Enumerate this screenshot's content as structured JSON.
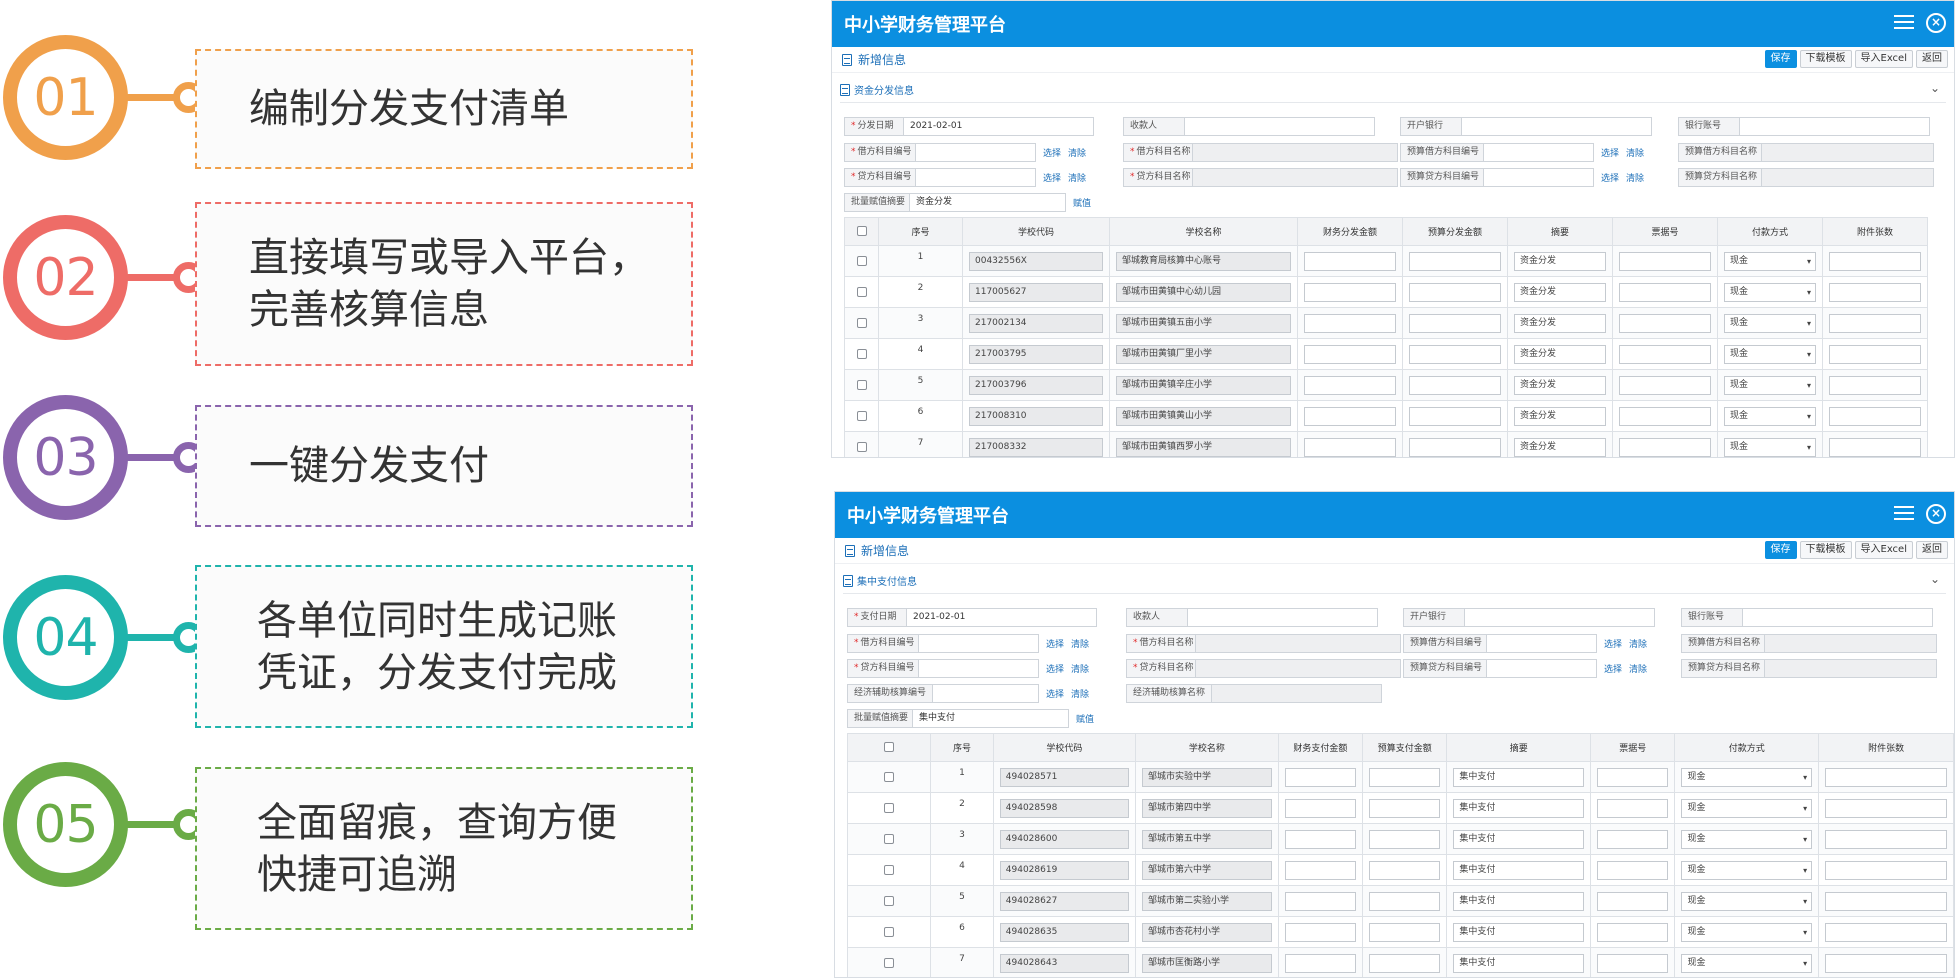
{
  "steps": [
    {
      "num": "01",
      "text": "编制分发支付清单",
      "color": "#f0a04b"
    },
    {
      "num": "02",
      "text": "直接填写或导入平台，\n完善核算信息",
      "color": "#ee6c67"
    },
    {
      "num": "03",
      "text": "一键分发支付",
      "color": "#8a64ad"
    },
    {
      "num": "04",
      "text": "各单位同时生成记账\n凭证，分发支付完成",
      "color": "#1fb4ac"
    },
    {
      "num": "05",
      "text": "全面留痕，查询方便\n快捷可追溯",
      "color": "#6aab46"
    }
  ],
  "panel1": {
    "title": "中小学财务管理平台",
    "new_info": "新增信息",
    "buttons": {
      "save": "保存",
      "download": "下载模板",
      "import": "导入Excel",
      "back": "返回"
    },
    "section": "资金分发信息",
    "form": {
      "date_label": "分发日期",
      "date_value": "2021-02-01",
      "payee_label": "收款人",
      "bank_label": "开户银行",
      "account_label": "银行账号",
      "debit_code": "借方科目编号",
      "debit_name": "借方科目名称",
      "credit_code": "贷方科目编号",
      "credit_name": "贷方科目名称",
      "budget_debit_code": "预算借方科目编号",
      "budget_debit_name": "预算借方科目名称",
      "budget_credit_code": "预算贷方科目编号",
      "budget_credit_name": "预算贷方科目名称",
      "select": "选择",
      "clear": "清除",
      "batch_label": "批量赋值摘要",
      "batch_value": "资金分发",
      "assign": "赋值"
    },
    "columns": [
      "序号",
      "学校代码",
      "学校名称",
      "财务分发金额",
      "预算分发金额",
      "摘要",
      "票据号",
      "付款方式",
      "附件张数"
    ],
    "rows": [
      {
        "no": "1",
        "code": "00432556X",
        "name": "邹城教育局核算中心账号",
        "memo": "资金分发",
        "pay": "现金"
      },
      {
        "no": "2",
        "code": "117005627",
        "name": "邹城市田黄镇中心幼儿园",
        "memo": "资金分发",
        "pay": "现金"
      },
      {
        "no": "3",
        "code": "217002134",
        "name": "邹城市田黄镇五亩小学",
        "memo": "资金分发",
        "pay": "现金"
      },
      {
        "no": "4",
        "code": "217003795",
        "name": "邹城市田黄镇厂里小学",
        "memo": "资金分发",
        "pay": "现金"
      },
      {
        "no": "5",
        "code": "217003796",
        "name": "邹城市田黄镇辛庄小学",
        "memo": "资金分发",
        "pay": "现金"
      },
      {
        "no": "6",
        "code": "217008310",
        "name": "邹城市田黄镇黄山小学",
        "memo": "资金分发",
        "pay": "现金"
      },
      {
        "no": "7",
        "code": "217008332",
        "name": "邹城市田黄镇西罗小学",
        "memo": "资金分发",
        "pay": "现金"
      }
    ]
  },
  "panel2": {
    "title": "中小学财务管理平台",
    "new_info": "新增信息",
    "buttons": {
      "save": "保存",
      "download": "下载模板",
      "import": "导入Excel",
      "back": "返回"
    },
    "section": "集中支付信息",
    "form": {
      "date_label": "支付日期",
      "date_value": "2021-02-01",
      "payee_label": "收款人",
      "bank_label": "开户银行",
      "account_label": "银行账号",
      "debit_code": "借方科目编号",
      "debit_name": "借方科目名称",
      "credit_code": "贷方科目编号",
      "credit_name": "贷方科目名称",
      "budget_debit_code": "预算借方科目编号",
      "budget_debit_name": "预算借方科目名称",
      "budget_credit_code": "预算贷方科目编号",
      "budget_credit_name": "预算贷方科目名称",
      "econ_code": "经济辅助核算编号",
      "econ_name": "经济辅助核算名称",
      "select": "选择",
      "clear": "清除",
      "batch_label": "批量赋值摘要",
      "batch_value": "集中支付",
      "assign": "赋值"
    },
    "columns": [
      "序号",
      "学校代码",
      "学校名称",
      "财务支付金额",
      "预算支付金额",
      "摘要",
      "票据号",
      "付款方式",
      "附件张数"
    ],
    "rows": [
      {
        "no": "1",
        "code": "494028571",
        "name": "邹城市实验中学",
        "memo": "集中支付",
        "pay": "现金"
      },
      {
        "no": "2",
        "code": "494028598",
        "name": "邹城市第四中学",
        "memo": "集中支付",
        "pay": "现金"
      },
      {
        "no": "3",
        "code": "494028600",
        "name": "邹城市第五中学",
        "memo": "集中支付",
        "pay": "现金"
      },
      {
        "no": "4",
        "code": "494028619",
        "name": "邹城市第六中学",
        "memo": "集中支付",
        "pay": "现金"
      },
      {
        "no": "5",
        "code": "494028627",
        "name": "邹城市第二实验小学",
        "memo": "集中支付",
        "pay": "现金"
      },
      {
        "no": "6",
        "code": "494028635",
        "name": "邹城市杏花村小学",
        "memo": "集中支付",
        "pay": "现金"
      },
      {
        "no": "7",
        "code": "494028643",
        "name": "邹城市匡衡路小学",
        "memo": "集中支付",
        "pay": "现金"
      }
    ]
  }
}
